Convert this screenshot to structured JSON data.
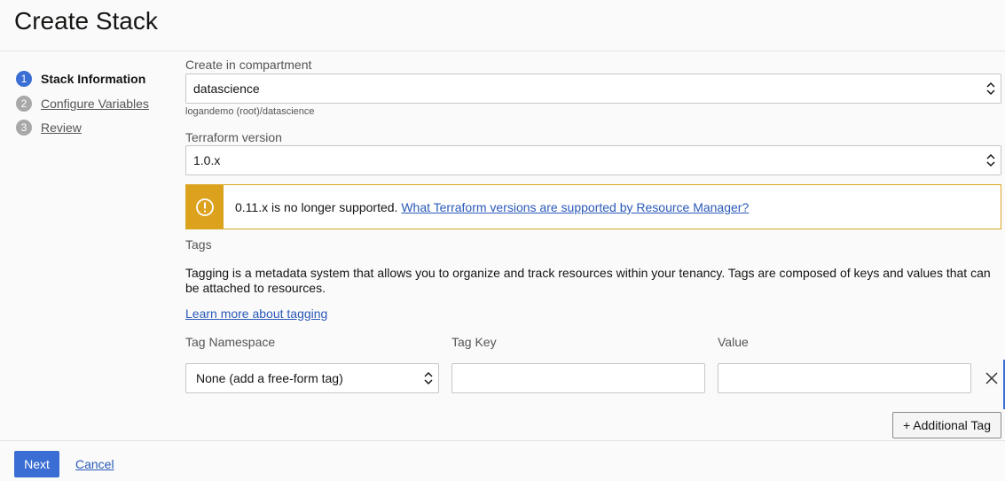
{
  "page": {
    "title": "Create Stack"
  },
  "steps": [
    {
      "number": "1",
      "label": "Stack Information",
      "state": "active"
    },
    {
      "number": "2",
      "label": "Configure Variables",
      "state": "link"
    },
    {
      "number": "3",
      "label": "Review",
      "state": "link"
    }
  ],
  "compartment": {
    "label": "Create in compartment",
    "value": "datascience",
    "path": "logandemo (root)/datascience"
  },
  "terraform": {
    "label": "Terraform version",
    "value": "1.0.x"
  },
  "alert": {
    "message": "0.11.x is no longer supported.",
    "link": "What Terraform versions are supported by Resource Manager?",
    "icon": "warning-icon",
    "color": "#dca21e"
  },
  "tags": {
    "title": "Tags",
    "description": "Tagging is a metadata system that allows you to organize and track resources within your tenancy. Tags are composed of keys and values that can be attached to resources.",
    "learn_more": "Learn more about tagging",
    "columns": {
      "namespace": "Tag Namespace",
      "key": "Tag Key",
      "value": "Value"
    },
    "row": {
      "namespace": "None (add a free-form tag)",
      "key": "",
      "value": ""
    },
    "add_button": "+ Additional Tag"
  },
  "footer": {
    "next": "Next",
    "cancel": "Cancel"
  },
  "colors": {
    "accent": "#3a6ed4",
    "link": "#2a59b8",
    "warning": "#dca21e"
  }
}
